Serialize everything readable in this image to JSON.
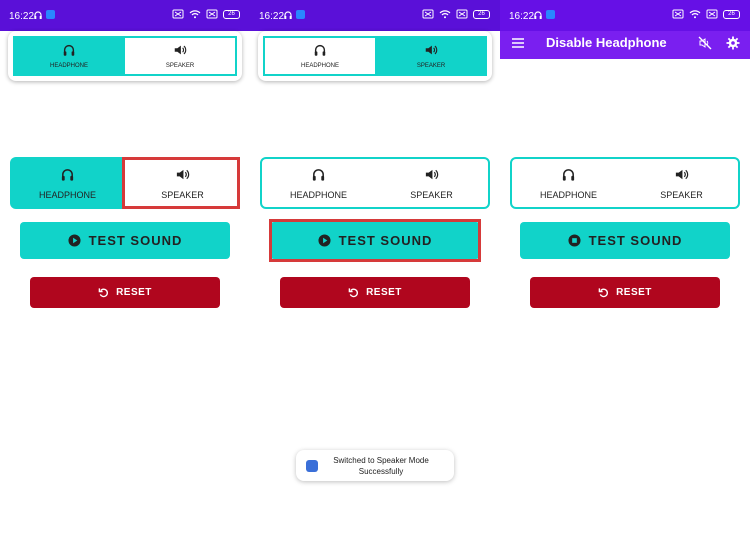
{
  "status_bar": {
    "time": "16:22",
    "battery": "26"
  },
  "app_bar": {
    "title": "Disable Headphone"
  },
  "labels": {
    "headphone": "HEADPHONE",
    "speaker": "SPEAKER",
    "test_sound": "TEST SOUND",
    "reset": "RESET"
  },
  "toast": {
    "message": "Switched to Speaker Mode Successfully"
  },
  "colors": {
    "status_bar": "#5a10d8",
    "app_bar": "#7a1ff0",
    "accent_teal": "#11d3c9",
    "reset_red": "#b0061e",
    "highlight_red": "#d63a3a"
  },
  "icons": [
    "headphones-icon",
    "speaker-icon",
    "play-icon",
    "stop-icon",
    "reset-icon",
    "menu-icon",
    "speaker-off-icon",
    "gear-icon"
  ]
}
